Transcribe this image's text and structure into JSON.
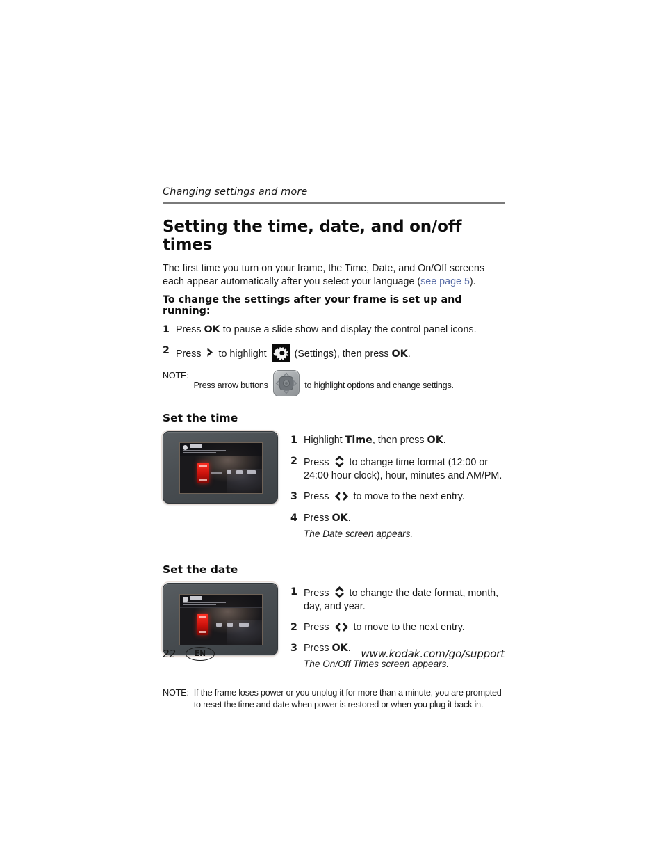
{
  "runhead": "Changing settings and more",
  "title": "Setting the time, date, and on/off times",
  "intro": {
    "before_link": "The first time you turn on your frame, the Time, Date, and On/Off screens each appear automatically after you select your language (",
    "link": "see page 5",
    "after_link": ")."
  },
  "lead_bold": "To change the settings after your frame is set up and running:",
  "steps_main": [
    {
      "num": "1",
      "parts": [
        {
          "t": "Press ",
          "b": false
        },
        {
          "t": "OK",
          "b": true
        },
        {
          "t": " to pause a slide show and display the control panel icons.",
          "b": false
        }
      ]
    },
    {
      "num": "2",
      "parts": [
        {
          "t": "Press ",
          "b": false
        },
        {
          "icon": "chevron-right-icon"
        },
        {
          "t": " to highlight ",
          "b": false
        },
        {
          "icon": "settings-gear-icon"
        },
        {
          "t": " (Settings), then press ",
          "b": false
        },
        {
          "t": "OK",
          "b": true
        },
        {
          "t": ".",
          "b": false
        }
      ]
    }
  ],
  "note_top": {
    "label": "NOTE:",
    "before_icon": "Press arrow buttons ",
    "icon": "nav-pad-icon",
    "after_icon": " to highlight options and change settings."
  },
  "section_time": {
    "heading": "Set the time",
    "figure_alt": "photo-frame-time-screen",
    "steps": [
      {
        "num": "1",
        "parts": [
          {
            "t": "Highlight ",
            "b": false
          },
          {
            "t": "Time",
            "b": true
          },
          {
            "t": ", then press ",
            "b": false
          },
          {
            "t": "OK",
            "b": true
          },
          {
            "t": ".",
            "b": false
          }
        ]
      },
      {
        "num": "2",
        "parts": [
          {
            "t": "Press ",
            "b": false
          },
          {
            "icon": "up-down-arrows-icon"
          },
          {
            "t": " to change time format (12:00 or 24:00 hour clock), hour, minutes and AM/PM.",
            "b": false
          }
        ]
      },
      {
        "num": "3",
        "parts": [
          {
            "t": "Press ",
            "b": false
          },
          {
            "icon": "left-right-arrows-icon"
          },
          {
            "t": " to move to the next entry.",
            "b": false
          }
        ]
      },
      {
        "num": "4",
        "parts": [
          {
            "t": "Press ",
            "b": false
          },
          {
            "t": "OK",
            "b": true
          },
          {
            "t": ".",
            "b": false
          }
        ],
        "result": "The Date screen appears."
      }
    ]
  },
  "section_date": {
    "heading": "Set the date",
    "figure_alt": "photo-frame-date-screen",
    "steps": [
      {
        "num": "1",
        "parts": [
          {
            "t": "Press ",
            "b": false
          },
          {
            "icon": "up-down-arrows-icon"
          },
          {
            "t": " to change the date format, month, day, and year.",
            "b": false
          }
        ]
      },
      {
        "num": "2",
        "parts": [
          {
            "t": "Press ",
            "b": false
          },
          {
            "icon": "left-right-arrows-icon"
          },
          {
            "t": " to move to the next entry.",
            "b": false
          }
        ]
      },
      {
        "num": "3",
        "parts": [
          {
            "t": "Press ",
            "b": false
          },
          {
            "t": "OK",
            "b": true
          },
          {
            "t": ".",
            "b": false
          }
        ],
        "result": "The On/Off Times screen appears."
      }
    ]
  },
  "note_bottom": {
    "label": "NOTE:",
    "text": "If the frame loses power or you unplug it for more than a minute, you are prompted to reset the time and date when power is restored or when you plug it back in."
  },
  "footer": {
    "page_number": "22",
    "language_badge": "EN",
    "url": "www.kodak.com/go/support"
  },
  "colors": {
    "rule": "#7a7a7a",
    "link": "#5b6fa8",
    "text": "#1a1a1a",
    "selection_red": "#d4130c"
  }
}
